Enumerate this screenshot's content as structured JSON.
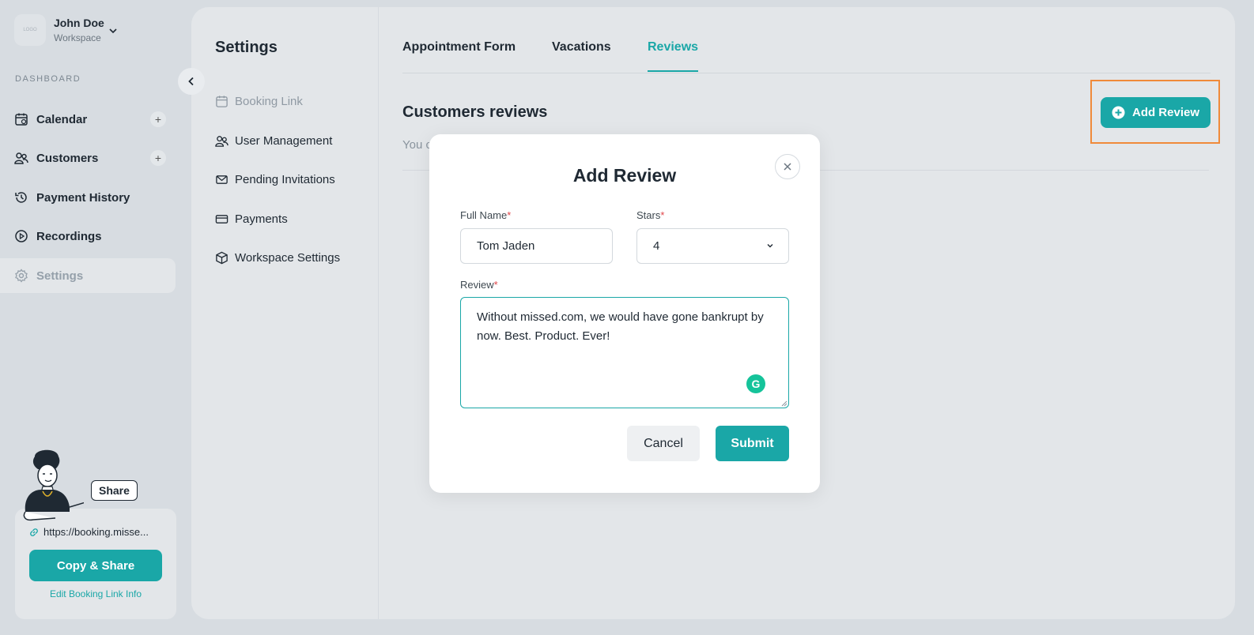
{
  "workspace": {
    "name": "John Doe",
    "subtitle": "Workspace",
    "logo_text": "LOGO"
  },
  "sidebar": {
    "section_label": "DASHBOARD",
    "items": [
      {
        "label": "Calendar",
        "icon": "calendar-icon",
        "has_add": true
      },
      {
        "label": "Customers",
        "icon": "users-icon",
        "has_add": true
      },
      {
        "label": "Payment History",
        "icon": "history-icon",
        "has_add": false
      },
      {
        "label": "Recordings",
        "icon": "play-circle-icon",
        "has_add": false
      },
      {
        "label": "Settings",
        "icon": "gear-icon",
        "has_add": false,
        "active": true
      }
    ],
    "add_symbol": "+"
  },
  "share": {
    "bubble": "Share",
    "link": "https://booking.misse...",
    "copy_button": "Copy & Share",
    "edit_link": "Edit Booking Link Info"
  },
  "settings": {
    "title": "Settings",
    "items": [
      {
        "label": "Booking Link",
        "icon": "calendar-icon",
        "muted": true
      },
      {
        "label": "User Management",
        "icon": "users-icon"
      },
      {
        "label": "Pending Invitations",
        "icon": "mail-icon"
      },
      {
        "label": "Payments",
        "icon": "credit-card-icon"
      },
      {
        "label": "Workspace Settings",
        "icon": "cube-icon"
      }
    ]
  },
  "tabs": [
    {
      "label": "Appointment Form",
      "active": false
    },
    {
      "label": "Vacations",
      "active": false
    },
    {
      "label": "Reviews",
      "active": true
    }
  ],
  "reviews": {
    "title": "Customers reviews",
    "subtitle": "You c",
    "add_button": "Add Review"
  },
  "modal": {
    "title": "Add Review",
    "full_name_label": "Full Name",
    "full_name_value": "Tom Jaden",
    "stars_label": "Stars",
    "stars_value": "4",
    "review_label": "Review",
    "review_value": "Without missed.com, we would have gone bankrupt by now. Best. Product. Ever!",
    "required_mark": "*",
    "cancel": "Cancel",
    "submit": "Submit",
    "grammarly_letter": "G"
  },
  "colors": {
    "accent": "#1aa7a7",
    "highlight": "#f08a3a",
    "required": "#e0464a"
  }
}
